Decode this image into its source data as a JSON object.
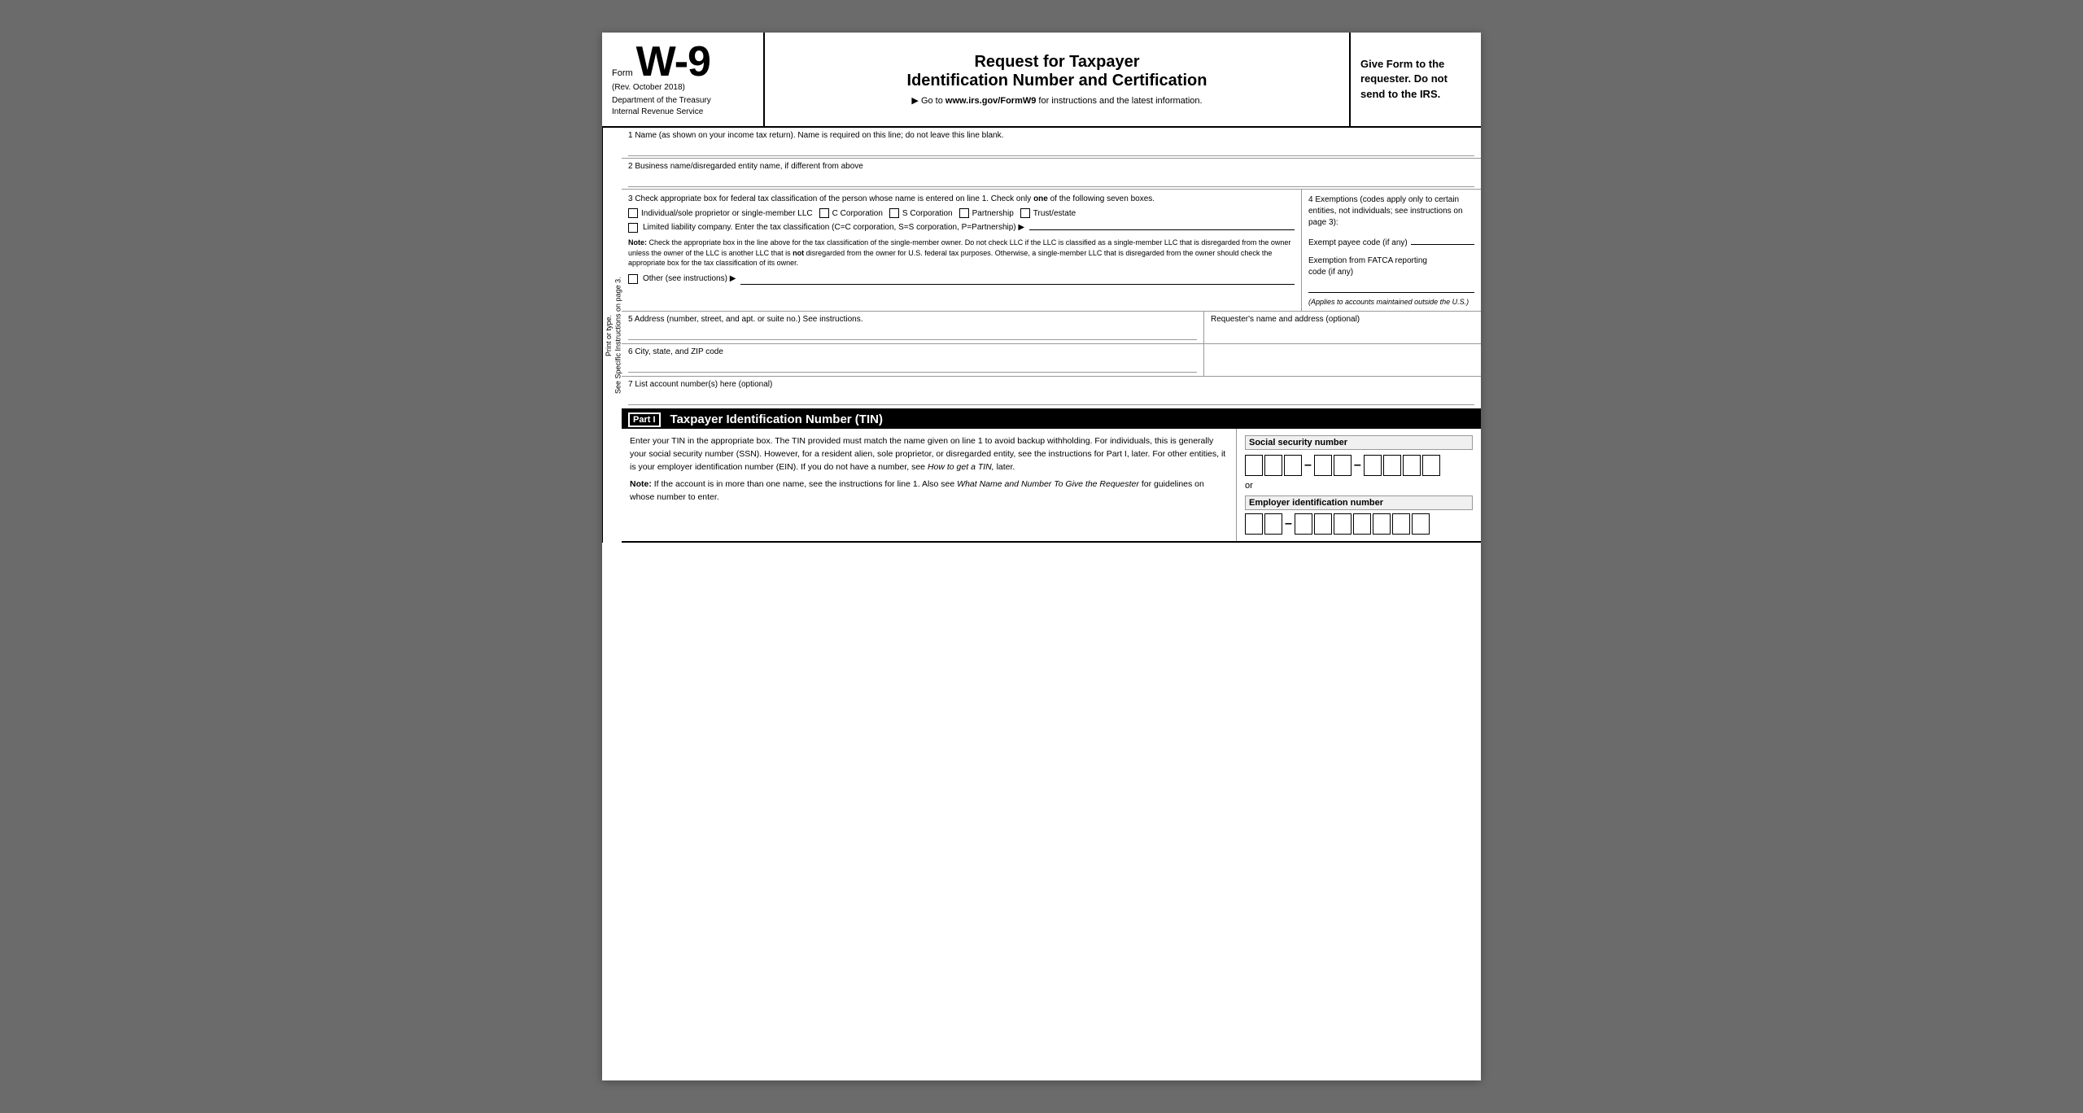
{
  "header": {
    "form_label": "Form",
    "form_number": "W-9",
    "form_rev": "(Rev. October 2018)",
    "form_dept": "Department of the Treasury\nInternal Revenue Service",
    "title_main": "Request for Taxpayer",
    "title_sub": "Identification Number and Certification",
    "url_text": "▶ Go to www.irs.gov/FormW9 for instructions and the latest information.",
    "give_form": "Give Form to the requester. Do not send to the IRS."
  },
  "side_labels": {
    "print_or_type": "Print or type.",
    "see_instructions": "See Specific Instructions on page 3."
  },
  "fields": {
    "field1_label": "1  Name (as shown on your income tax return). Name is required on this line; do not leave this line blank.",
    "field2_label": "2  Business name/disregarded entity name, if different from above",
    "field3_label": "3  Check appropriate box for federal tax classification of the person whose name is entered on line 1. Check only",
    "field3_label_bold": "one",
    "field3_label_end": "of the following seven boxes.",
    "field4_label": "4  Exemptions (codes apply only to certain entities, not individuals; see instructions on page 3):",
    "individual_label": "Individual/sole proprietor or single-member LLC",
    "c_corp_label": "C Corporation",
    "s_corp_label": "S Corporation",
    "partnership_label": "Partnership",
    "trust_estate_label": "Trust/estate",
    "llc_label": "Limited liability company. Enter the tax classification (C=C corporation, S=S corporation, P=Partnership) ▶",
    "note_label": "Note:",
    "note_text": "Check the appropriate box in the line above for the tax classification of the single-member owner.  Do not check LLC if the LLC is classified as a single-member LLC that is disregarded from the owner unless the owner of the LLC is another LLC that is",
    "note_not": "not",
    "note_text2": "disregarded from the owner for U.S. federal tax purposes. Otherwise, a single-member LLC that is disregarded from the owner should check the appropriate box for the tax classification of its owner.",
    "other_label": "Other (see instructions) ▶",
    "exempt_payee_label": "Exempt payee code (if any)",
    "fatca_label": "Exemption from FATCA reporting\ncode (if any)",
    "fatca_note": "(Applies to accounts maintained outside the U.S.)",
    "field5_label": "5  Address (number, street, and apt. or suite no.) See instructions.",
    "requester_label": "Requester's name and address (optional)",
    "field6_label": "6  City, state, and ZIP code",
    "field7_label": "7  List account number(s) here (optional)",
    "part1_label": "Part I",
    "part1_title": "Taxpayer Identification Number (TIN)",
    "part1_text": "Enter your TIN in the appropriate box. The TIN provided must match the name given on line 1 to avoid backup withholding. For individuals, this is generally your social security number (SSN). However, for a resident alien, sole proprietor, or disregarded entity, see the instructions for Part I, later. For other entities, it is your employer identification number (EIN). If you do not have a number, see",
    "part1_italic": "How to get a TIN,",
    "part1_text2": "later.",
    "part1_note_label": "Note:",
    "part1_note_text": "If the account is in more than one name, see the instructions for line 1. Also see",
    "part1_note_italic": "What Name and Number To Give the Requester",
    "part1_note_text2": "for guidelines on whose number to enter.",
    "ssn_label": "Social security number",
    "or_text": "or",
    "ein_label": "Employer identification number"
  }
}
